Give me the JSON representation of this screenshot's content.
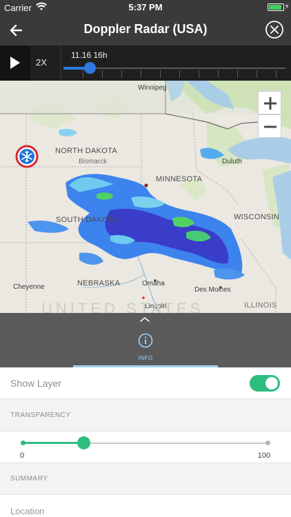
{
  "status_bar": {
    "carrier": "Carrier",
    "time": "5:37 PM",
    "battery_level": 0.9,
    "wifi_icon": "wifi-icon",
    "charging_icon": "bolt-icon"
  },
  "nav": {
    "title": "Doppler Radar (USA)",
    "back_icon": "arrow-left-icon",
    "close_icon": "close-circle-icon"
  },
  "playback": {
    "play_icon": "play-icon",
    "speed": "2X",
    "time_label": "11.16 16h",
    "position": 0.12,
    "accent": "#2d7ae0"
  },
  "map": {
    "labels": {
      "winnipeg": "Winnipeg",
      "north_dakota": "NORTH DAKOTA",
      "bismarck": "Bismarck",
      "minnesota": "MINNESOTA",
      "duluth": "Duluth",
      "south_dakota": "SOUTH DAKOTA",
      "wisconsin": "WISCONSIN",
      "nebraska": "NEBRASKA",
      "omaha": "Omaha",
      "cheyenne": "Cheyenne",
      "des_moines": "Des Moines",
      "lincoln": "Lincoln",
      "illinois": "ILLINOIS",
      "united_states": "UNITED STATES"
    },
    "zoom_in_icon": "plus-icon",
    "zoom_out_icon": "minus-icon",
    "marker_icon": "snowflake-icon"
  },
  "drawer": {
    "handle_icon": "chevron-up-icon",
    "tab": {
      "label": "INFO",
      "icon": "info-circle-icon",
      "accent": "#9fd3ff"
    }
  },
  "settings": {
    "show_layer": {
      "label": "Show Layer",
      "enabled": true,
      "accent": "#2dbd7e"
    },
    "transparency": {
      "header": "TRANSPARENCY",
      "min": "0",
      "max": "100",
      "value": 25
    },
    "summary_header": "SUMMARY",
    "location_label": "Location"
  }
}
